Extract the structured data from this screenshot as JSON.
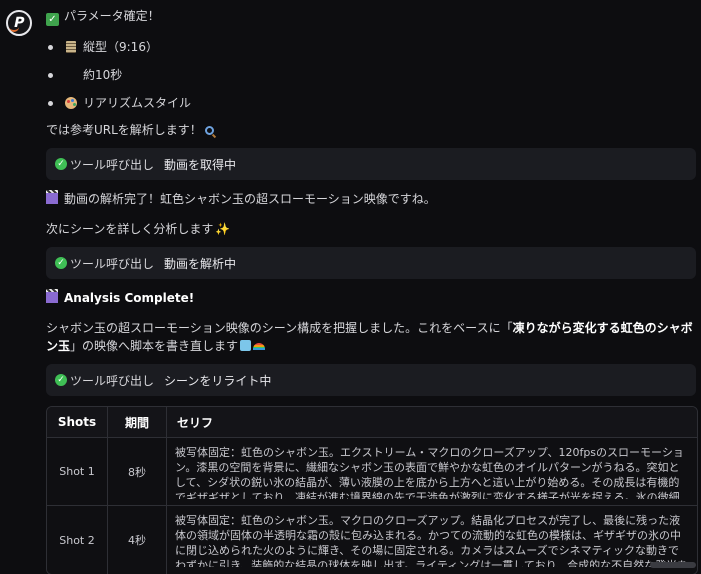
{
  "message": {
    "confirm_title": "パラメータ確定！",
    "params": [
      {
        "icon": "calendar-icon",
        "label": "縦型（9:16）"
      },
      {
        "icon": "blank-icon",
        "label": "約10秒"
      },
      {
        "icon": "palette-icon",
        "label": "リアリズムスタイル"
      }
    ],
    "intro_text": "では参考URLを解析します！",
    "tool_calls": [
      {
        "label": "ツール呼び出し",
        "action": "動画を取得中"
      },
      {
        "label": "ツール呼び出し",
        "action": "動画を解析中"
      },
      {
        "label": "ツール呼び出し",
        "action": "シーンをリライト中"
      }
    ],
    "analysis_done": "動画の解析完了！虹色シャボン玉の超スローモーション映像ですね。",
    "next_scene": "次にシーンを詳しく分析します",
    "analysis_complete_title": "Analysis Complete!",
    "summary_pre": "シャボン玉の超スローモーション映像のシーン構成を把握しました。これをベースに「",
    "summary_bold": "凍りながら変化する虹色のシャボン玉",
    "summary_post": "」の映像へ脚本を書き直します"
  },
  "table": {
    "headers": [
      "Shots",
      "期間",
      "セリフ"
    ],
    "rows": [
      {
        "shot": "Shot 1",
        "duration": "8秒",
        "text": "被写体固定：虹色のシャボン玉。エクストリーム・マクロのクローズアップ、120fpsのスローモーション。漆黒の空間を背景に、繊細なシャボン玉の表面で鮮やかな虹色のオイルパターンがうねる。突如として、シダ状の鋭い氷の結晶が、薄い液膜の上を底から上方へと這い上がり始める。その成長は有機的でギザギザとしており、凍結が進む境界線の先で干渉色が激烈に変化する様子が光を捉える。氷の微細な質感や表面張力"
      },
      {
        "shot": "Shot 2",
        "duration": "4秒",
        "text": "被写体固定：虹色のシャボン玉。マクロのクローズアップ。結晶化プロセスが完了し、最後に残った液体の領域が固体の半透明な霜の殻に包み込まれる。かつての流動的な虹色の模様は、ギザギザの氷の中に閉じ込められた火のように輝き、その場に固定される。カメラはスムーズでシネマティックな動きでわずかに引き、装飾的な結晶の球体を映し出す。ライティングは一貫しており、合成的な不自然な発光を排除し、複雑"
      }
    ]
  },
  "colors": {
    "background": "#0d0d10",
    "tool_bar": "#1b1c21",
    "check_green": "#3fbf55"
  }
}
